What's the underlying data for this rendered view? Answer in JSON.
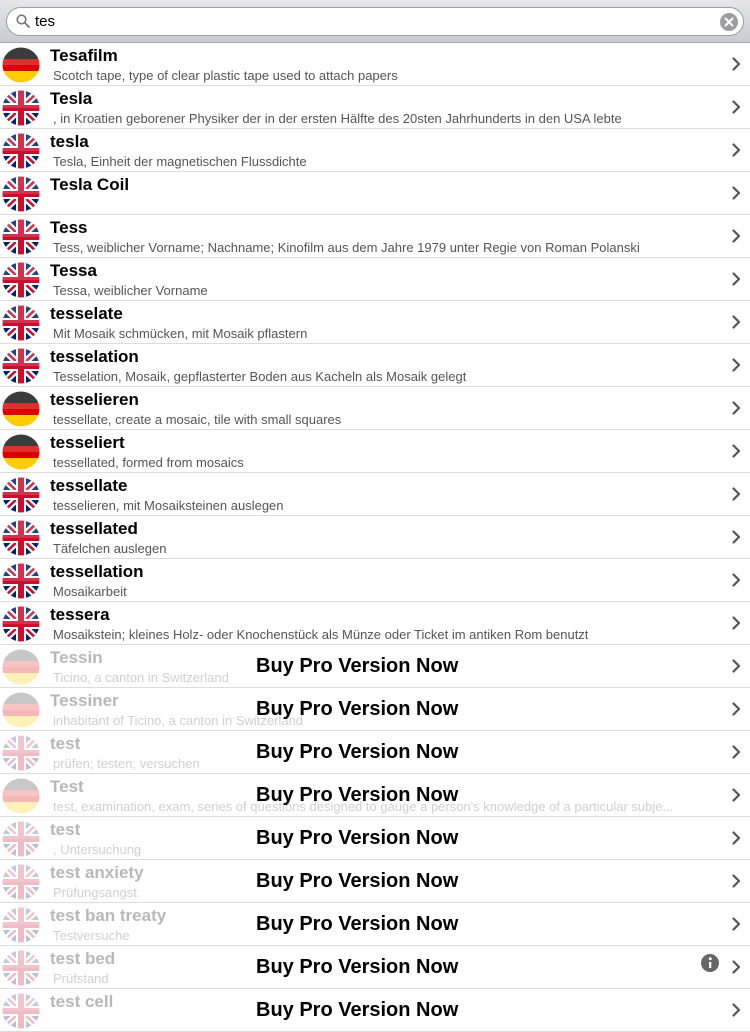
{
  "search": {
    "value": "tes",
    "placeholder": ""
  },
  "promo_label": "Buy Pro Version Now",
  "rows": [
    {
      "word": "Tesafilm",
      "def": "Scotch tape, type of clear plastic tape used to attach papers",
      "flag": "de",
      "locked": false
    },
    {
      "word": "Tesla",
      "def": ", in Kroatien geborener Physiker der in der ersten Hälfte des 20sten Jahrhunderts in den USA lebte",
      "flag": "uk",
      "locked": false
    },
    {
      "word": "tesla",
      "def": "Tesla, Einheit der magnetischen Flussdichte",
      "flag": "uk",
      "locked": false
    },
    {
      "word": "Tesla Coil",
      "def": "",
      "flag": "uk",
      "locked": false
    },
    {
      "word": "Tess",
      "def": "Tess, weiblicher Vorname; Nachname; Kinofilm aus dem Jahre 1979 unter Regie von Roman Polanski",
      "flag": "uk",
      "locked": false
    },
    {
      "word": "Tessa",
      "def": "Tessa, weiblicher Vorname",
      "flag": "uk",
      "locked": false
    },
    {
      "word": "tesselate",
      "def": "Mit Mosaik schmücken, mit Mosaik pflastern",
      "flag": "uk",
      "locked": false
    },
    {
      "word": "tesselation",
      "def": "Tesselation, Mosaik, gepflasterter Boden aus Kacheln als Mosaik gelegt",
      "flag": "uk",
      "locked": false
    },
    {
      "word": "tesselieren",
      "def": "tessellate, create a mosaic, tile with small squares",
      "flag": "de",
      "locked": false
    },
    {
      "word": "tesseliert",
      "def": "tessellated, formed from mosaics",
      "flag": "de",
      "locked": false
    },
    {
      "word": "tessellate",
      "def": "tesselieren, mit Mosaiksteinen auslegen",
      "flag": "uk",
      "locked": false
    },
    {
      "word": "tessellated",
      "def": "Täfelchen auslegen",
      "flag": "uk",
      "locked": false
    },
    {
      "word": "tessellation",
      "def": "Mosaikarbeit",
      "flag": "uk",
      "locked": false
    },
    {
      "word": "tessera",
      "def": "Mosaikstein; kleines Holz- oder Knochenstück als Münze oder Ticket im antiken Rom benutzt",
      "flag": "uk",
      "locked": false
    },
    {
      "word": "Tessin",
      "def": "Ticino, a canton in Switzerland",
      "flag": "de",
      "locked": true
    },
    {
      "word": "Tessiner",
      "def": "inhabitant of Ticino, a canton in Switzerland",
      "flag": "de",
      "locked": true
    },
    {
      "word": "test",
      "def": "prüfen; testen; versuchen",
      "flag": "uk",
      "locked": true
    },
    {
      "word": "Test",
      "def": "test, examination, exam, series of questions designed to gauge a person's knowledge of a particular subje...",
      "flag": "de",
      "locked": true
    },
    {
      "word": "test",
      "def": ", Untersuchung",
      "flag": "uk",
      "locked": true
    },
    {
      "word": "test anxiety",
      "def": "Prüfungsangst",
      "flag": "uk",
      "locked": true
    },
    {
      "word": "test ban treaty",
      "def": "Testversuche",
      "flag": "uk",
      "locked": true
    },
    {
      "word": "test bed",
      "def": "Prüfstand",
      "flag": "uk",
      "locked": true,
      "info": true
    },
    {
      "word": "test cell",
      "def": "",
      "flag": "uk",
      "locked": true
    }
  ]
}
